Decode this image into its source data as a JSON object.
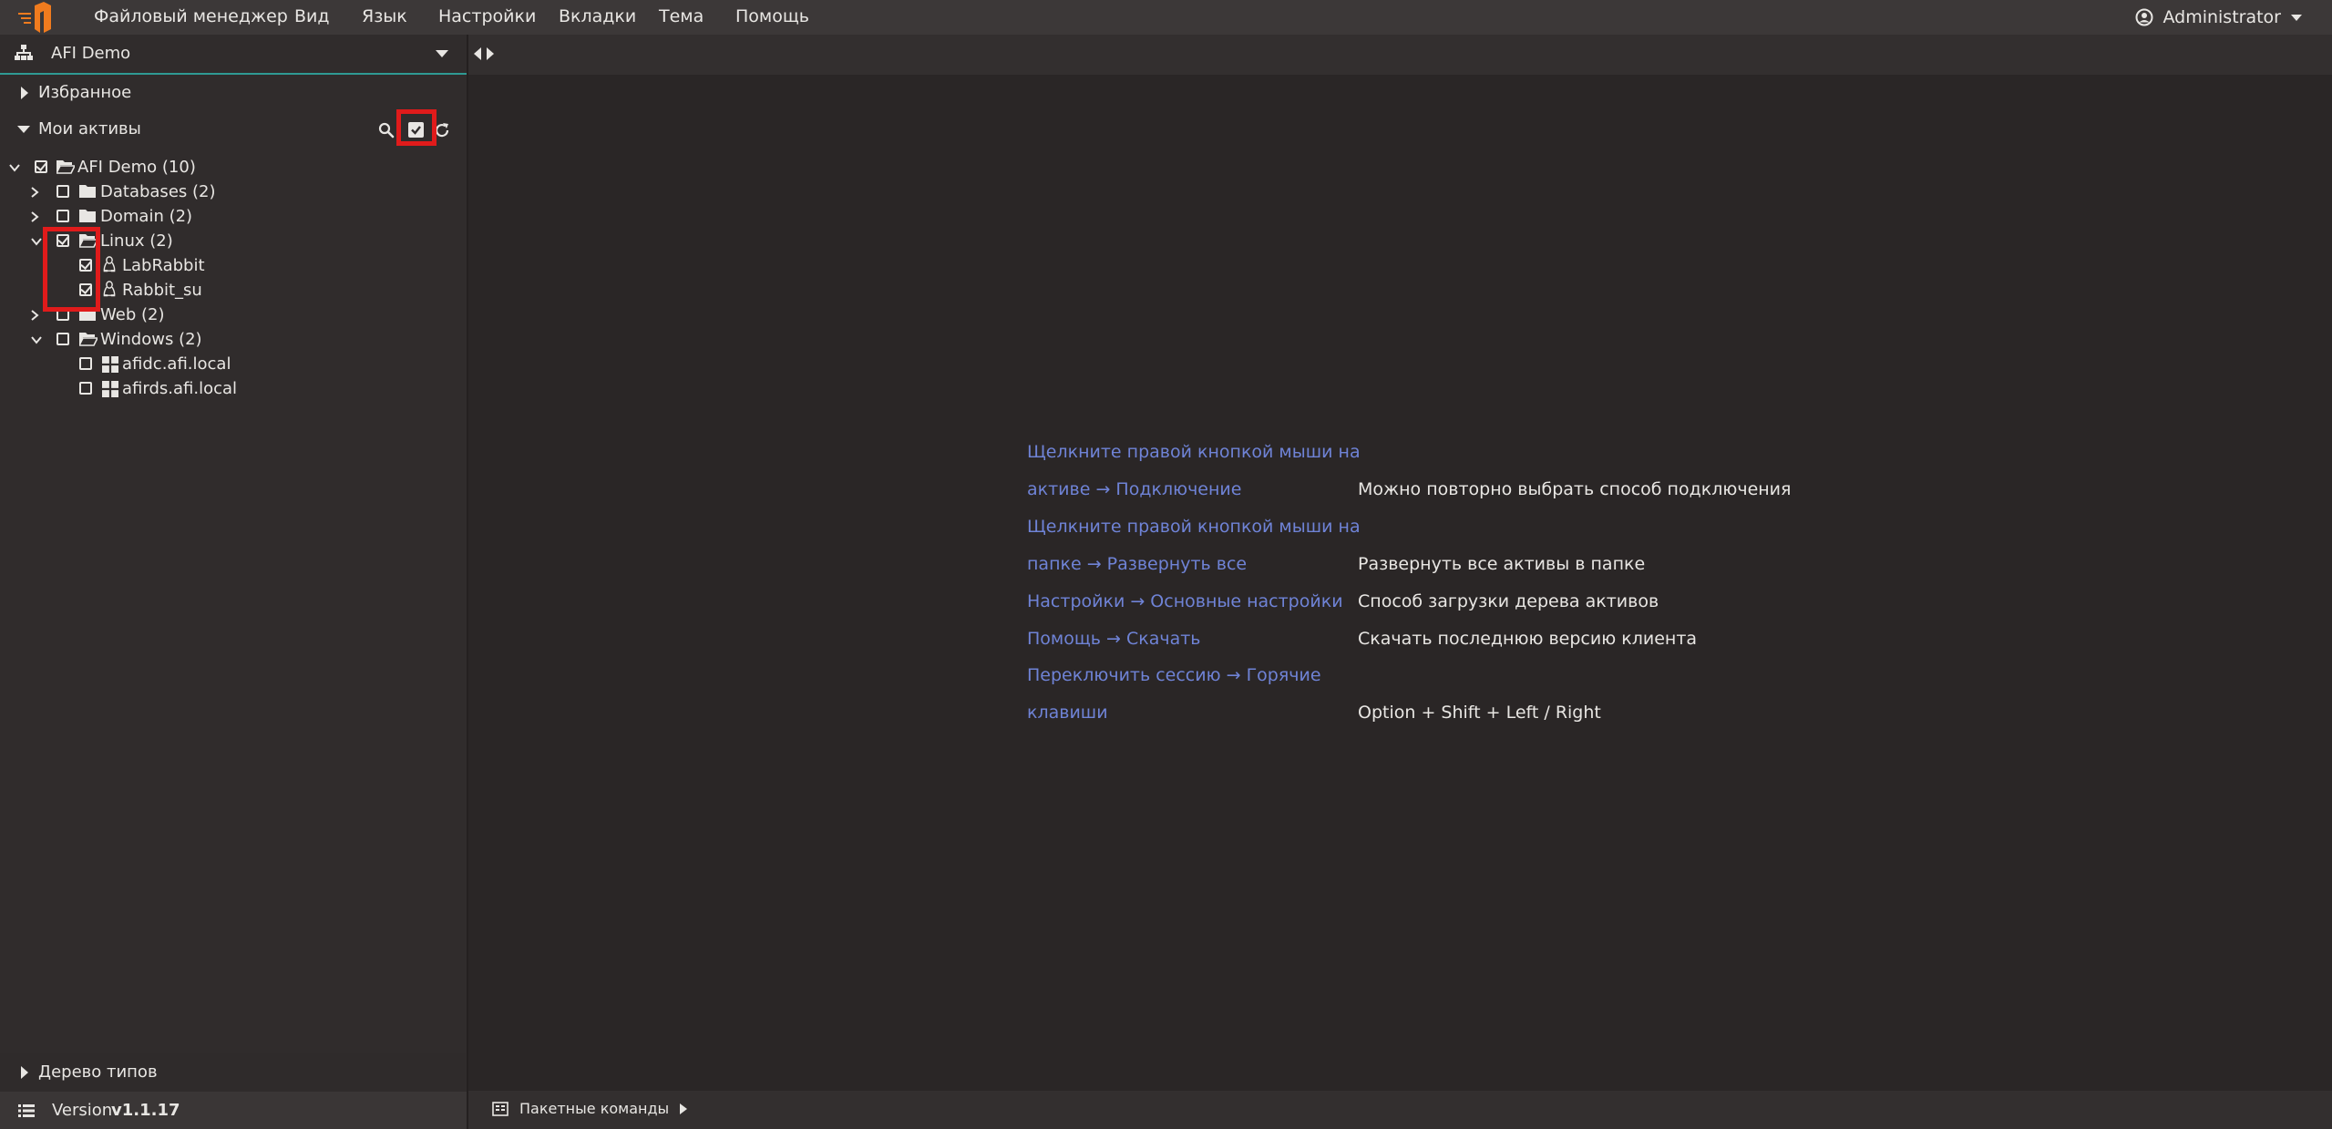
{
  "menubar": {
    "items": [
      "Файловый менеджер",
      "Вид",
      "Язык",
      "Настройки",
      "Вкладки",
      "Тема",
      "Помощь"
    ],
    "user": "Administrator",
    "brand_color": "#f07b1e"
  },
  "sidebar": {
    "workspace": "AFI Demo",
    "favorites": "Избранное",
    "my_assets": "Мои активы",
    "tree": [
      {
        "label": "AFI Demo (10)",
        "expanded": true,
        "checked": true,
        "type": "folder-open"
      },
      {
        "label": "Databases (2)",
        "expanded": false,
        "checked": false,
        "type": "folder"
      },
      {
        "label": "Domain (2)",
        "expanded": false,
        "checked": false,
        "type": "folder"
      },
      {
        "label": "Linux (2)",
        "expanded": true,
        "checked": true,
        "type": "folder-open"
      },
      {
        "label": "LabRabbit",
        "checked": true,
        "type": "linux"
      },
      {
        "label": "Rabbit_su",
        "checked": true,
        "type": "linux"
      },
      {
        "label": "Web (2)",
        "expanded": false,
        "checked": false,
        "type": "folder"
      },
      {
        "label": "Windows (2)",
        "expanded": true,
        "checked": false,
        "type": "folder-open"
      },
      {
        "label": "afidc.afi.local",
        "checked": false,
        "type": "windows"
      },
      {
        "label": "afirds.afi.local",
        "checked": false,
        "type": "windows"
      }
    ],
    "type_tree": "Дерево типов",
    "version_label": "Version",
    "version": "v1.1.17"
  },
  "main": {
    "tips": [
      {
        "link_lines": [
          "Щелкните правой кнопкой мыши на",
          "активе → Подключение"
        ],
        "desc": "Можно повторно выбрать способ подключения"
      },
      {
        "link_lines": [
          "Щелкните правой кнопкой мыши на",
          "папке → Развернуть все"
        ],
        "desc": "Развернуть все активы в папке"
      },
      {
        "link_lines": [
          "Настройки → Основные настройки"
        ],
        "desc": "Способ загрузки дерева активов"
      },
      {
        "link_lines": [
          "Помощь → Скачать"
        ],
        "desc": "Скачать последнюю версию клиента"
      },
      {
        "link_lines": [
          "Переключить сессию → Горячие",
          "клавиши"
        ],
        "desc": "Option + Shift + Left / Right"
      }
    ]
  },
  "statusbar": {
    "batch": "Пакетные команды"
  }
}
